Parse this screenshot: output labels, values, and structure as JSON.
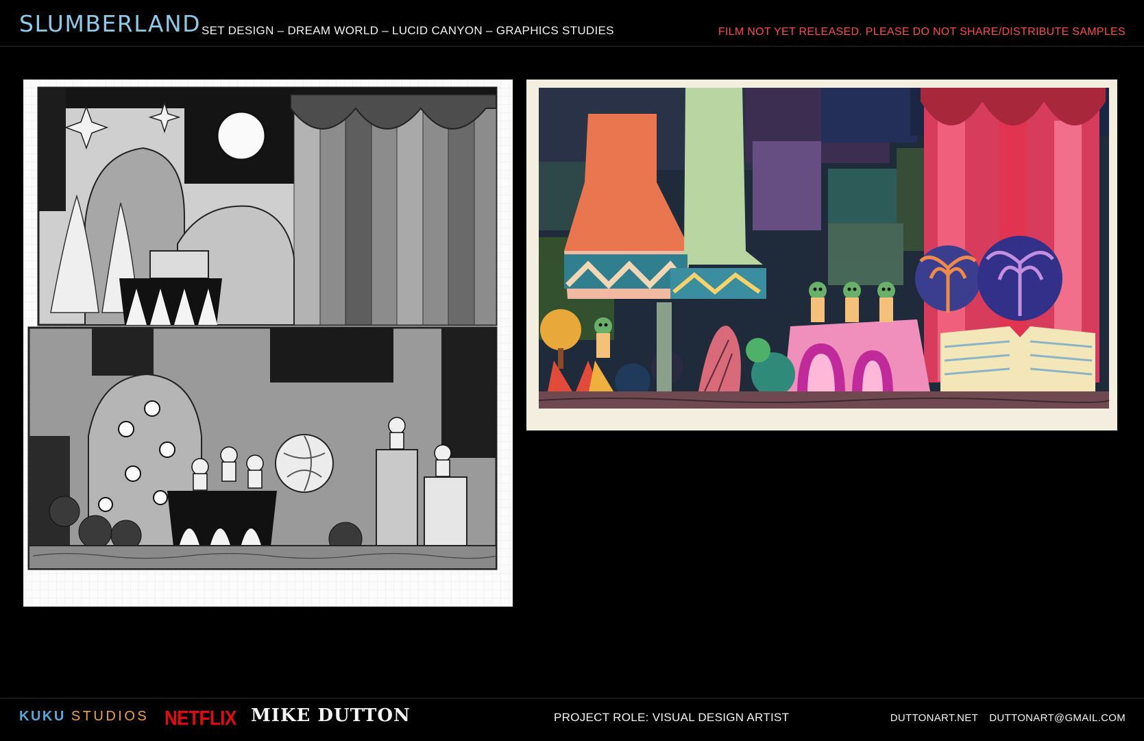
{
  "header": {
    "title": "SLUMBERLAND",
    "breadcrumb": "SET DESIGN – DREAM WORLD –  LUCID CANYON – GRAPHICS STUDIES",
    "notice": "FILM NOT YET RELEASED. PLEASE DO NOT SHARE/DISTRIBUTE SAMPLES"
  },
  "artworks": [
    {
      "name": "pencil-sketch",
      "palette": "grayscale"
    },
    {
      "name": "gouache-color-study",
      "palette": "color"
    }
  ],
  "footer": {
    "studio_part1": "KUKU",
    "studio_part2": "STUDIOS",
    "distributor": "NETFLIX",
    "artist": "MIKE DUTTON",
    "role": "PROJECT ROLE: VISUAL DESIGN ARTIST",
    "website": "DUTTONART.NET",
    "email": "DUTTONART@GMAIL.COM"
  },
  "colors": {
    "background": "#000000",
    "title": "#8ec9e8",
    "notice": "#ff4a4a",
    "text": "#f2f2f2",
    "kuku_blue": "#5aa7d8",
    "kuku_orange": "#f0a436",
    "netflix_red": "#e50914"
  }
}
